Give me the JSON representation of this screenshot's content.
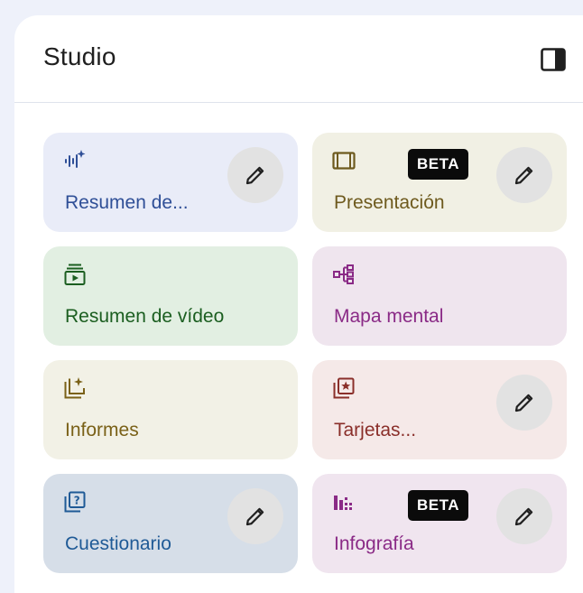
{
  "panel": {
    "title": "Studio",
    "toggle_icon": "dock-to-right-icon"
  },
  "colors": {
    "background": "#eef1fa",
    "beta_badge": "#0b0b0b",
    "edit_button": "#e2e2e2"
  },
  "cards": [
    {
      "label": "Resumen de...",
      "icon": "audio-overview-sparkle-icon",
      "bg": "#e9ecf8",
      "fg": "#2f4f97",
      "edit": true,
      "beta": ""
    },
    {
      "label": "Presentación",
      "icon": "slides-icon",
      "bg": "#f1f0e4",
      "fg": "#6e5a1e",
      "edit": true,
      "beta": "BETA"
    },
    {
      "label": "Resumen de vídeo",
      "icon": "video-overview-icon",
      "bg": "#e2efe2",
      "fg": "#1b5e20",
      "edit": false,
      "beta": ""
    },
    {
      "label": "Mapa mental",
      "icon": "mind-map-icon",
      "bg": "#efe5ee",
      "fg": "#8a2a86",
      "edit": false,
      "beta": ""
    },
    {
      "label": "Informes",
      "icon": "reports-sparkle-icon",
      "bg": "#f2f1e6",
      "fg": "#7a6118",
      "edit": false,
      "beta": ""
    },
    {
      "label": "Tarjetas...",
      "icon": "flashcards-icon",
      "bg": "#f5e9e8",
      "fg": "#8a2f2a",
      "edit": true,
      "beta": ""
    },
    {
      "label": "Cuestionario",
      "icon": "quiz-icon",
      "bg": "#d6dee8",
      "fg": "#1f5a96",
      "edit": true,
      "beta": ""
    },
    {
      "label": "Infografía",
      "icon": "infographic-icon",
      "bg": "#f0e5ef",
      "fg": "#8a2a86",
      "edit": true,
      "beta": "BETA"
    }
  ]
}
